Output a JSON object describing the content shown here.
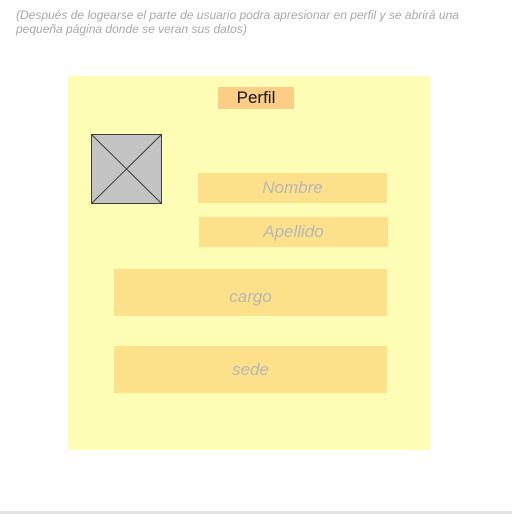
{
  "note": {
    "text": "(Después de logearse  el parte de usuario podra apresionar en perfil y se abrirá una pequeña página donde se veran sus datos)"
  },
  "profile_card": {
    "title": "Perfil",
    "fields": {
      "nombre": "Nombre",
      "apellido": "Apellido",
      "cargo": "cargo",
      "sede": "sede"
    }
  },
  "icons": {
    "avatar": "image-placeholder-icon"
  },
  "colors": {
    "card_background": "#fdfdb5",
    "title_background": "#fbcd85",
    "field_background": "#fde18a",
    "avatar_placeholder": "#c4c4c4",
    "placeholder_text": "#b7b7b7",
    "note_text": "#a8a8a8"
  }
}
